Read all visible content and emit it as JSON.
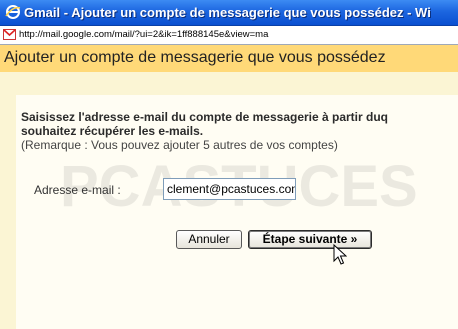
{
  "window": {
    "title": "Gmail - Ajouter un compte de messagerie que vous possédez - Wi",
    "app_icon": "ie-icon"
  },
  "address_bar": {
    "favicon": "gmail-favicon",
    "url": "http://mail.google.com/mail/?ui=2&ik=1ff888145e&view=ma"
  },
  "page": {
    "heading": "Ajouter un compte de messagerie que vous possédez",
    "description_line1": "Saisissez l'adresse e-mail du compte de messagerie à partir duq",
    "description_line2": "souhaitez récupérer les e-mails.",
    "note": "(Remarque : Vous pouvez ajouter 5 autres de vos comptes)"
  },
  "form": {
    "email_label": "Adresse e-mail :",
    "email_value": "clement@pcastuces.com",
    "cancel_label": "Annuler",
    "next_label": "Étape suivante »"
  },
  "watermark_text": "PCASTUCES",
  "colors": {
    "titlebar": "#1c66e0",
    "header_bg": "#ffd978",
    "content_bg": "#fbf5d4"
  }
}
